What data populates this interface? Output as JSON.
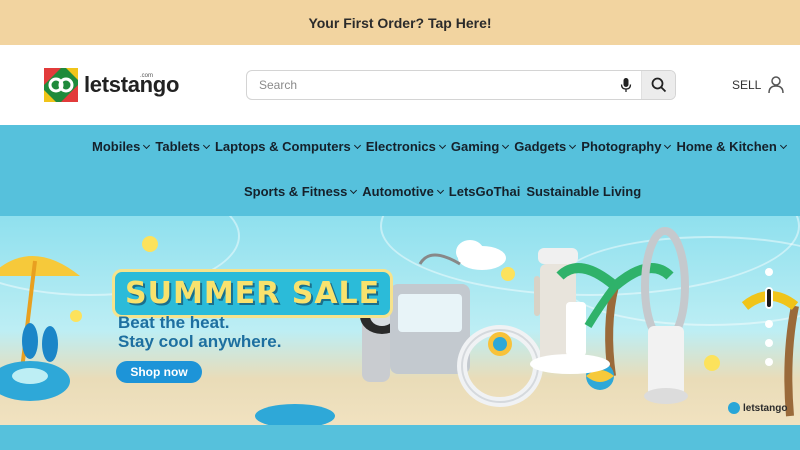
{
  "promo": {
    "text": "Your First Order? Tap Here!"
  },
  "header": {
    "logo_text": "letstango",
    "logo_sub": ".com",
    "search_placeholder": "Search",
    "sell_label": "SELL",
    "icons": [
      "mic-icon",
      "search-icon",
      "user-icon"
    ]
  },
  "nav": {
    "row1": [
      {
        "label": "Mobiles",
        "has_dropdown": true
      },
      {
        "label": "Tablets",
        "has_dropdown": true
      },
      {
        "label": "Laptops & Computers",
        "has_dropdown": true
      },
      {
        "label": "Electronics",
        "has_dropdown": true
      },
      {
        "label": "Gaming",
        "has_dropdown": true
      },
      {
        "label": "Gadgets",
        "has_dropdown": true
      },
      {
        "label": "Photography",
        "has_dropdown": true
      },
      {
        "label": "Home & Kitchen",
        "has_dropdown": true
      }
    ],
    "row2": [
      {
        "label": "Sports & Fitness",
        "has_dropdown": true
      },
      {
        "label": "Automotive",
        "has_dropdown": true
      },
      {
        "label": "LetsGoThai",
        "has_dropdown": false
      },
      {
        "label": "Sustainable Living",
        "has_dropdown": false
      }
    ]
  },
  "hero": {
    "title": "SUMMER SALE",
    "subtitle_line1": "Beat the heat.",
    "subtitle_line2": "Stay cool anywhere.",
    "cta_label": "Shop now",
    "brand_tag": "letstango",
    "slide_count": 5,
    "active_slide_index": 1
  },
  "colors": {
    "promo_bg": "#f2d4a0",
    "nav_bg": "#56c1dc",
    "cta_bg": "#1d94d8",
    "title_yellow": "#f8e26d"
  }
}
